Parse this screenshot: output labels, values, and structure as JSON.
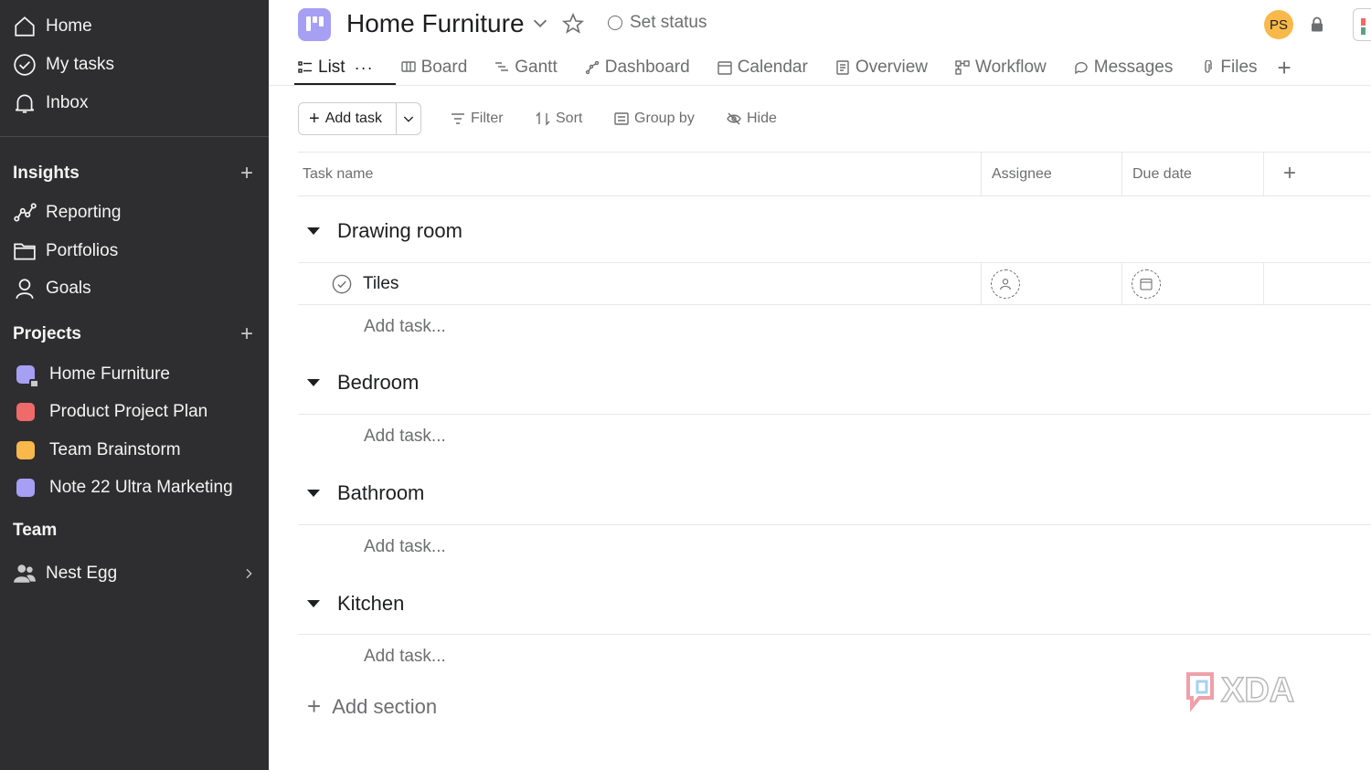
{
  "sidebar": {
    "top_nav": [
      {
        "label": "Home",
        "icon": "home-icon"
      },
      {
        "label": "My tasks",
        "icon": "check-circle-icon"
      },
      {
        "label": "Inbox",
        "icon": "bell-icon"
      }
    ],
    "insights": {
      "title": "Insights",
      "items": [
        {
          "label": "Reporting",
          "icon": "reporting-icon"
        },
        {
          "label": "Portfolios",
          "icon": "folder-icon"
        },
        {
          "label": "Goals",
          "icon": "goals-icon"
        }
      ]
    },
    "projects": {
      "title": "Projects",
      "items": [
        {
          "label": "Home Furniture",
          "color": "#a69ff3"
        },
        {
          "label": "Product Project Plan",
          "color": "#f06a6a"
        },
        {
          "label": "Team Brainstorm",
          "color": "#f8b94a"
        },
        {
          "label": "Note 22 Ultra Marketing",
          "color": "#a69ff3"
        }
      ]
    },
    "team": {
      "title": "Team",
      "items": [
        {
          "label": "Nest Egg",
          "icon": "people-icon"
        }
      ]
    }
  },
  "header": {
    "project_title": "Home Furniture",
    "set_status": "Set status",
    "avatar_initials": "PS"
  },
  "tabs": [
    {
      "label": "List",
      "icon": "list-icon",
      "active": true
    },
    {
      "label": "Board",
      "icon": "board-icon"
    },
    {
      "label": "Gantt",
      "icon": "gantt-icon"
    },
    {
      "label": "Dashboard",
      "icon": "dashboard-icon"
    },
    {
      "label": "Calendar",
      "icon": "calendar-icon"
    },
    {
      "label": "Overview",
      "icon": "overview-icon"
    },
    {
      "label": "Workflow",
      "icon": "workflow-icon"
    },
    {
      "label": "Messages",
      "icon": "message-icon"
    },
    {
      "label": "Files",
      "icon": "paperclip-icon"
    }
  ],
  "toolbar": {
    "add_task": "Add task",
    "filter": "Filter",
    "sort": "Sort",
    "group_by": "Group by",
    "hide": "Hide"
  },
  "table": {
    "columns": [
      "Task name",
      "Assignee",
      "Due date"
    ],
    "sections": [
      {
        "title": "Drawing room",
        "tasks": [
          "Tiles"
        ],
        "add_task": "Add task..."
      },
      {
        "title": "Bedroom",
        "tasks": [],
        "add_task": "Add task..."
      },
      {
        "title": "Bathroom",
        "tasks": [],
        "add_task": "Add task..."
      },
      {
        "title": "Kitchen",
        "tasks": [],
        "add_task": "Add task..."
      }
    ],
    "add_section": "Add section"
  },
  "watermark": "XDA",
  "colors": {
    "sidebar_bg": "#2e2e30",
    "accent_purple": "#a69ff3",
    "avatar_bg": "#f8b94a"
  }
}
